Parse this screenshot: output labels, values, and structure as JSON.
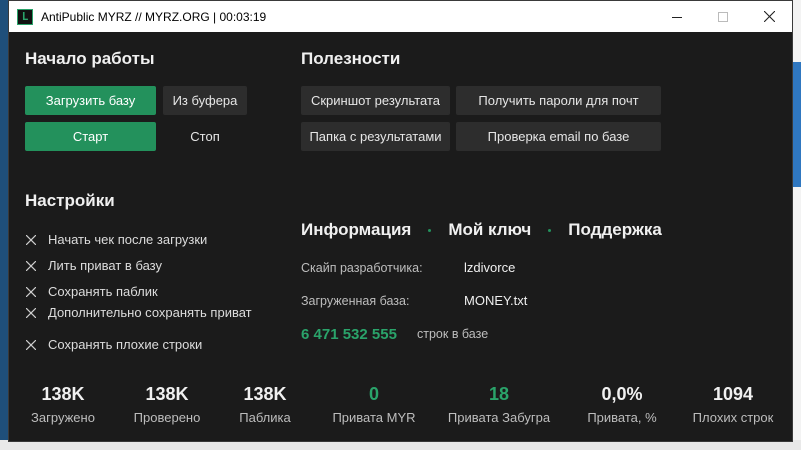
{
  "window": {
    "title": "AntiPublic MYRZ // MYRZ.ORG | 00:03:19",
    "app_icon_glyph": "L"
  },
  "start_section": {
    "title": "Начало работы",
    "load_base_label": "Загрузить базу",
    "from_clipboard_label": "Из буфера",
    "start_label": "Старт",
    "stop_label": "Стоп"
  },
  "useful_section": {
    "title": "Полезности",
    "screenshot_label": "Скриншот результата",
    "get_passwords_label": "Получить пароли для почт",
    "results_folder_label": "Папка с результатами",
    "check_email_label": "Проверка email по базе"
  },
  "settings_section": {
    "title": "Настройки",
    "options": [
      {
        "label": "Начать чек после загрузки"
      },
      {
        "label": "Лить приват в базу"
      },
      {
        "label": "Сохранять паблик"
      },
      {
        "label": "Дополнительно сохранять приват"
      },
      {
        "label": "Сохранять плохие строки"
      }
    ]
  },
  "info_section": {
    "tabs": [
      {
        "label": "Информация"
      },
      {
        "label": "Мой ключ"
      },
      {
        "label": "Поддержка"
      }
    ],
    "developer_skype_label": "Скайп разработчика:",
    "developer_skype_value": "lzdivorce",
    "loaded_base_label": "Загруженная база:",
    "loaded_base_value": "MONEY.txt",
    "rows_count": "6 471 532 555",
    "rows_label": "строк в базе"
  },
  "stats": [
    {
      "value": "138K",
      "label": "Загружено"
    },
    {
      "value": "138K",
      "label": "Проверено"
    },
    {
      "value": "138K",
      "label": "Паблика"
    },
    {
      "value": "0",
      "label": "Привата MYR"
    },
    {
      "value": "18",
      "label": "Привата Забугра"
    },
    {
      "value": "0,0%",
      "label": "Привата, %"
    },
    {
      "value": "1094",
      "label": "Плохих строк"
    }
  ],
  "colors": {
    "accent_green": "#23915c",
    "window_bg": "#1b1b1b",
    "button_bg": "#2d2d2d"
  }
}
